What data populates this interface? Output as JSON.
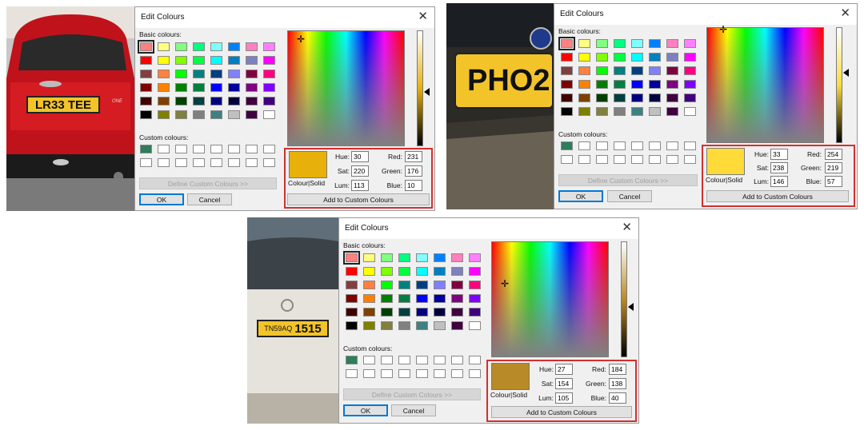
{
  "dialog_common": {
    "title": "Edit Colours",
    "basic_label": "Basic colours:",
    "custom_label": "Custom colours:",
    "define_button": "Define Custom Colours >>",
    "ok_button": "OK",
    "cancel_button": "Cancel",
    "colour_solid_label": "Colour|Solid",
    "add_button": "Add to Custom Colours",
    "hue_label": "Hue:",
    "sat_label": "Sat:",
    "lum_label": "Lum:",
    "red_label": "Red:",
    "green_label": "Green:",
    "blue_label": "Blue:"
  },
  "basic_colours": [
    "#ff8080",
    "#ffff80",
    "#80ff80",
    "#00ff80",
    "#80ffff",
    "#0080ff",
    "#ff80c0",
    "#ff80ff",
    "#ff0000",
    "#ffff00",
    "#80ff00",
    "#00ff40",
    "#00ffff",
    "#0080c0",
    "#8080c0",
    "#ff00ff",
    "#804040",
    "#ff8040",
    "#00ff00",
    "#008080",
    "#004080",
    "#8080ff",
    "#800040",
    "#ff0080",
    "#800000",
    "#ff8000",
    "#008000",
    "#008040",
    "#0000ff",
    "#0000a0",
    "#800080",
    "#8000ff",
    "#400000",
    "#804000",
    "#004000",
    "#004040",
    "#000080",
    "#000040",
    "#400040",
    "#400080",
    "#000000",
    "#808000",
    "#808040",
    "#808080",
    "#408080",
    "#c0c0c0",
    "#400040",
    "#ffffff"
  ],
  "panels": [
    {
      "plate_text": "LR33 TEE",
      "badge_text": "ONE",
      "custom_first": "#2e7d5b",
      "preview_color": "#e7b00a",
      "hue": "30",
      "sat": "220",
      "lum": "113",
      "red": "231",
      "green": "176",
      "blue": "10"
    },
    {
      "plate_text": "PHO2",
      "custom_first": "#2e7d5b",
      "preview_color": "#fedb39",
      "hue": "33",
      "sat": "238",
      "lum": "146",
      "red": "254",
      "green": "219",
      "blue": "57"
    },
    {
      "plate_text_small": "TN59AQ",
      "plate_text_large": "1515",
      "custom_first": "#2e7d5b",
      "preview_color": "#b88a28",
      "hue": "27",
      "sat": "154",
      "lum": "105",
      "red": "184",
      "green": "138",
      "blue": "40"
    }
  ]
}
